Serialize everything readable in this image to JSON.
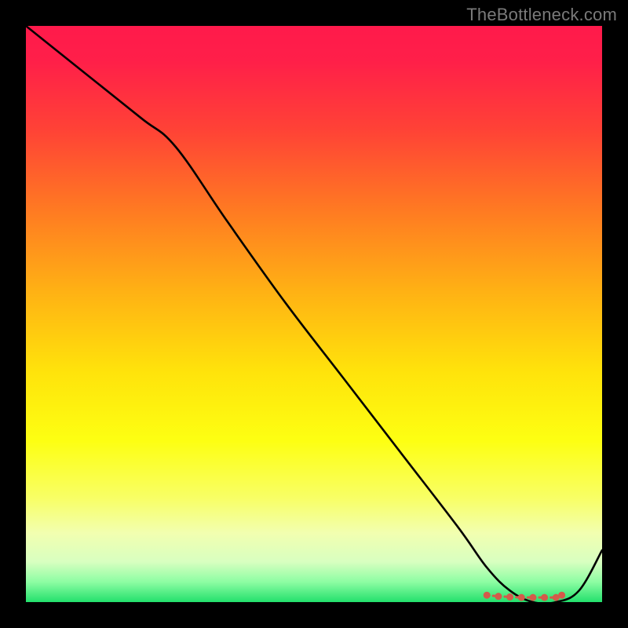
{
  "watermark": "TheBottleneck.com",
  "chart_data": {
    "type": "line",
    "title": "",
    "xlabel": "",
    "ylabel": "",
    "xlim": [
      0,
      100
    ],
    "ylim": [
      0,
      100
    ],
    "series": [
      {
        "name": "bottleneck-curve",
        "x": [
          0,
          10,
          20,
          26,
          35,
          45,
          55,
          65,
          75,
          80,
          84,
          88,
          92,
          96,
          100
        ],
        "values": [
          100,
          92,
          84,
          79,
          66,
          52,
          39,
          26,
          13,
          6,
          2,
          0,
          0,
          2,
          9
        ]
      }
    ],
    "gradient_stops": [
      {
        "pos": 0.0,
        "color": "#ff1a4b"
      },
      {
        "pos": 0.06,
        "color": "#ff1f49"
      },
      {
        "pos": 0.18,
        "color": "#ff4236"
      },
      {
        "pos": 0.32,
        "color": "#ff7a22"
      },
      {
        "pos": 0.46,
        "color": "#ffb114"
      },
      {
        "pos": 0.6,
        "color": "#ffe30b"
      },
      {
        "pos": 0.72,
        "color": "#fdff12"
      },
      {
        "pos": 0.82,
        "color": "#f8ff66"
      },
      {
        "pos": 0.88,
        "color": "#f2ffb0"
      },
      {
        "pos": 0.93,
        "color": "#d8ffc0"
      },
      {
        "pos": 0.965,
        "color": "#8dfda3"
      },
      {
        "pos": 1.0,
        "color": "#23e06c"
      }
    ],
    "markers": {
      "name": "optimal-region",
      "color": "#d45a4a",
      "x": [
        80,
        82,
        84,
        86,
        88,
        90,
        92,
        93
      ],
      "values": [
        1.2,
        1.0,
        0.9,
        0.8,
        0.8,
        0.8,
        0.8,
        1.2
      ]
    }
  }
}
